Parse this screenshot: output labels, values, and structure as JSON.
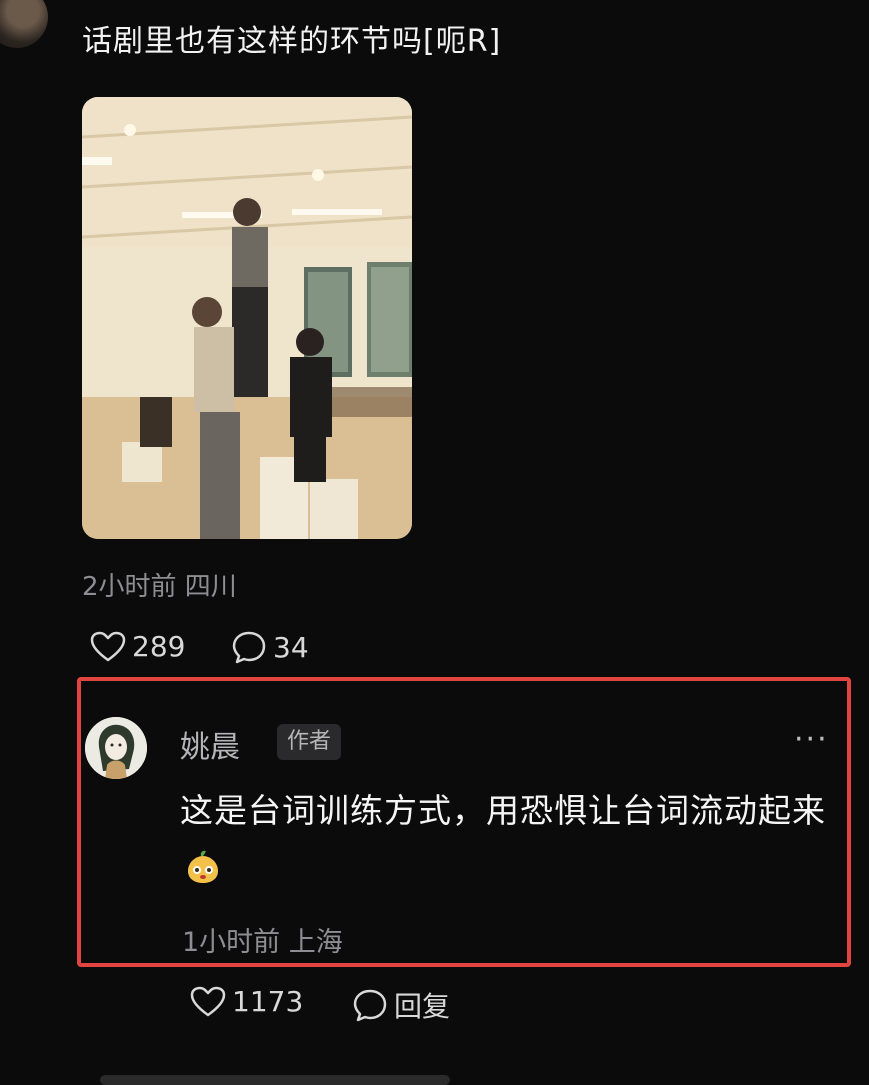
{
  "post": {
    "text": "话剧里也有这样的环节吗[呃R]",
    "meta": "2小时前 四川",
    "likes": "289",
    "comments": "34"
  },
  "comment": {
    "author": "姚晨",
    "badge": "作者",
    "more": "···",
    "text": "这是台词训练方式，用恐惧让台词流动起来",
    "meta": "1小时前 上海",
    "likes": "1173",
    "reply_label": "回复",
    "highlight_color": "#e2453f"
  },
  "icons": [
    "heart-icon",
    "comment-bubble-icon",
    "more-icon"
  ]
}
